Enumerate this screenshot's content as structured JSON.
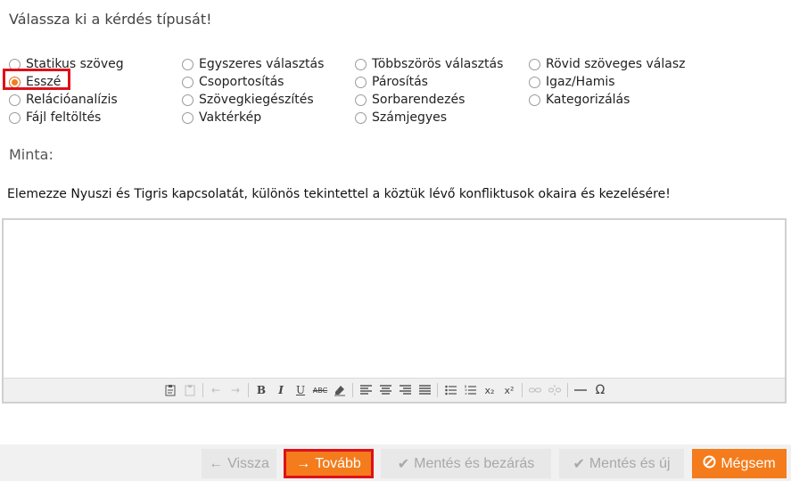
{
  "page": {
    "title": "Válassza ki a kérdés típusát!",
    "sample_label": "Minta:",
    "question": "Elemezze Nyuszi és Tigris kapcsolatát, különös tekintettel a köztük lévő konfliktusok okaira és kezelésére!"
  },
  "question_types": {
    "selected": "Esszé",
    "options": [
      "Statikus szöveg",
      "Esszé",
      "Relációanalízis",
      "Fájl feltöltés",
      "Egyszeres választás",
      "Csoportosítás",
      "Szövegkiegészítés",
      "Vaktérkép",
      "Többszörös választás",
      "Párosítás",
      "Sorbarendezés",
      "Számjegyes",
      "Rövid szöveges válasz",
      "Igaz/Hamis",
      "Kategorizálás"
    ]
  },
  "editor": {
    "toolbar": {
      "bold": "B",
      "italic": "I",
      "underline": "U",
      "strike": "ABC",
      "subscript": "x₂",
      "superscript": "x²",
      "omega": "Ω"
    }
  },
  "buttons": {
    "back": "Vissza",
    "next": "Tovább",
    "save_close": "Mentés és bezárás",
    "save_new": "Mentés és új",
    "cancel": "Mégsem"
  },
  "colors": {
    "accent": "#f47c1c",
    "highlight": "#e0101a",
    "disabled_bg": "#e8e8e8"
  }
}
